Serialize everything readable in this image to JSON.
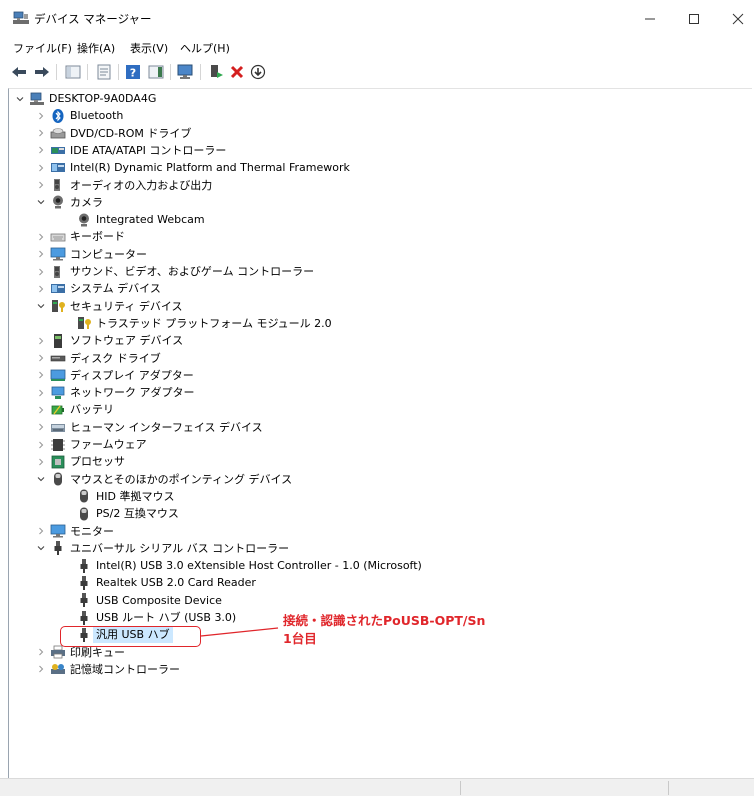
{
  "window": {
    "title": "デバイス マネージャー"
  },
  "menu": [
    "ファイル(F)",
    "操作(A)",
    "表示(V)",
    "ヘルプ(H)"
  ],
  "tree": [
    {
      "label": "DESKTOP-9A0DA4G",
      "level": 0,
      "expand": "open",
      "icon": "computer-icon"
    },
    {
      "label": "Bluetooth",
      "level": 1,
      "expand": "closed",
      "icon": "bluetooth-icon"
    },
    {
      "label": "DVD/CD-ROM ドライブ",
      "level": 1,
      "expand": "closed",
      "icon": "dvd-drive-icon"
    },
    {
      "label": "IDE ATA/ATAPI コントローラー",
      "level": 1,
      "expand": "closed",
      "icon": "ide-controller-icon"
    },
    {
      "label": "Intel(R) Dynamic Platform and Thermal Framework",
      "level": 1,
      "expand": "closed",
      "icon": "system-device-icon"
    },
    {
      "label": "オーディオの入力および出力",
      "level": 1,
      "expand": "closed",
      "icon": "speaker-icon"
    },
    {
      "label": "カメラ",
      "level": 1,
      "expand": "open",
      "icon": "webcam-icon"
    },
    {
      "label": "Integrated Webcam",
      "level": 2,
      "expand": "none",
      "icon": "webcam-icon"
    },
    {
      "label": "キーボード",
      "level": 1,
      "expand": "closed",
      "icon": "keyboard-icon"
    },
    {
      "label": "コンピューター",
      "level": 1,
      "expand": "closed",
      "icon": "monitor-icon"
    },
    {
      "label": "サウンド、ビデオ、およびゲーム コントローラー",
      "level": 1,
      "expand": "closed",
      "icon": "speaker-icon"
    },
    {
      "label": "システム デバイス",
      "level": 1,
      "expand": "closed",
      "icon": "system-device-icon"
    },
    {
      "label": "セキュリティ デバイス",
      "level": 1,
      "expand": "open",
      "icon": "security-key-icon"
    },
    {
      "label": "トラステッド プラットフォーム モジュール 2.0",
      "level": 2,
      "expand": "none",
      "icon": "security-key-icon"
    },
    {
      "label": "ソフトウェア デバイス",
      "level": 1,
      "expand": "closed",
      "icon": "software-device-icon"
    },
    {
      "label": "ディスク ドライブ",
      "level": 1,
      "expand": "closed",
      "icon": "disk-drive-icon"
    },
    {
      "label": "ディスプレイ アダプター",
      "level": 1,
      "expand": "closed",
      "icon": "display-adapter-icon"
    },
    {
      "label": "ネットワーク アダプター",
      "level": 1,
      "expand": "closed",
      "icon": "network-icon"
    },
    {
      "label": "バッテリ",
      "level": 1,
      "expand": "closed",
      "icon": "battery-icon"
    },
    {
      "label": "ヒューマン インターフェイス デバイス",
      "level": 1,
      "expand": "closed",
      "icon": "hid-icon"
    },
    {
      "label": "ファームウェア",
      "level": 1,
      "expand": "closed",
      "icon": "firmware-icon"
    },
    {
      "label": "プロセッサ",
      "level": 1,
      "expand": "closed",
      "icon": "processor-icon"
    },
    {
      "label": "マウスとそのほかのポインティング デバイス",
      "level": 1,
      "expand": "open",
      "icon": "mouse-icon"
    },
    {
      "label": "HID 準拠マウス",
      "level": 2,
      "expand": "none",
      "icon": "mouse-icon"
    },
    {
      "label": "PS/2 互換マウス",
      "level": 2,
      "expand": "none",
      "icon": "mouse-icon"
    },
    {
      "label": "モニター",
      "level": 1,
      "expand": "closed",
      "icon": "monitor-icon"
    },
    {
      "label": "ユニバーサル シリアル バス コントローラー",
      "level": 1,
      "expand": "open",
      "icon": "usb-plug-icon"
    },
    {
      "label": "Intel(R) USB 3.0 eXtensible Host Controller - 1.0 (Microsoft)",
      "level": 2,
      "expand": "none",
      "icon": "usb-plug-icon"
    },
    {
      "label": "Realtek USB 2.0 Card Reader",
      "level": 2,
      "expand": "none",
      "icon": "usb-plug-icon"
    },
    {
      "label": "USB Composite Device",
      "level": 2,
      "expand": "none",
      "icon": "usb-plug-icon"
    },
    {
      "label": "USB ルート ハブ (USB 3.0)",
      "level": 2,
      "expand": "none",
      "icon": "usb-plug-icon"
    },
    {
      "label": "汎用 USB ハブ",
      "level": 2,
      "expand": "none",
      "icon": "usb-plug-icon",
      "selected": true
    },
    {
      "label": "印刷キュー",
      "level": 1,
      "expand": "closed",
      "icon": "printer-icon"
    },
    {
      "label": "記憶域コントローラー",
      "level": 1,
      "expand": "closed",
      "icon": "storage-controller-icon"
    }
  ],
  "annotation": {
    "line1": "接続・認識されたPoUSB-OPT/Sn",
    "line2": "1台目",
    "color": "#e0262b"
  },
  "colors": {
    "selection": "#cce8ff",
    "accent": "#1f7ad2"
  }
}
